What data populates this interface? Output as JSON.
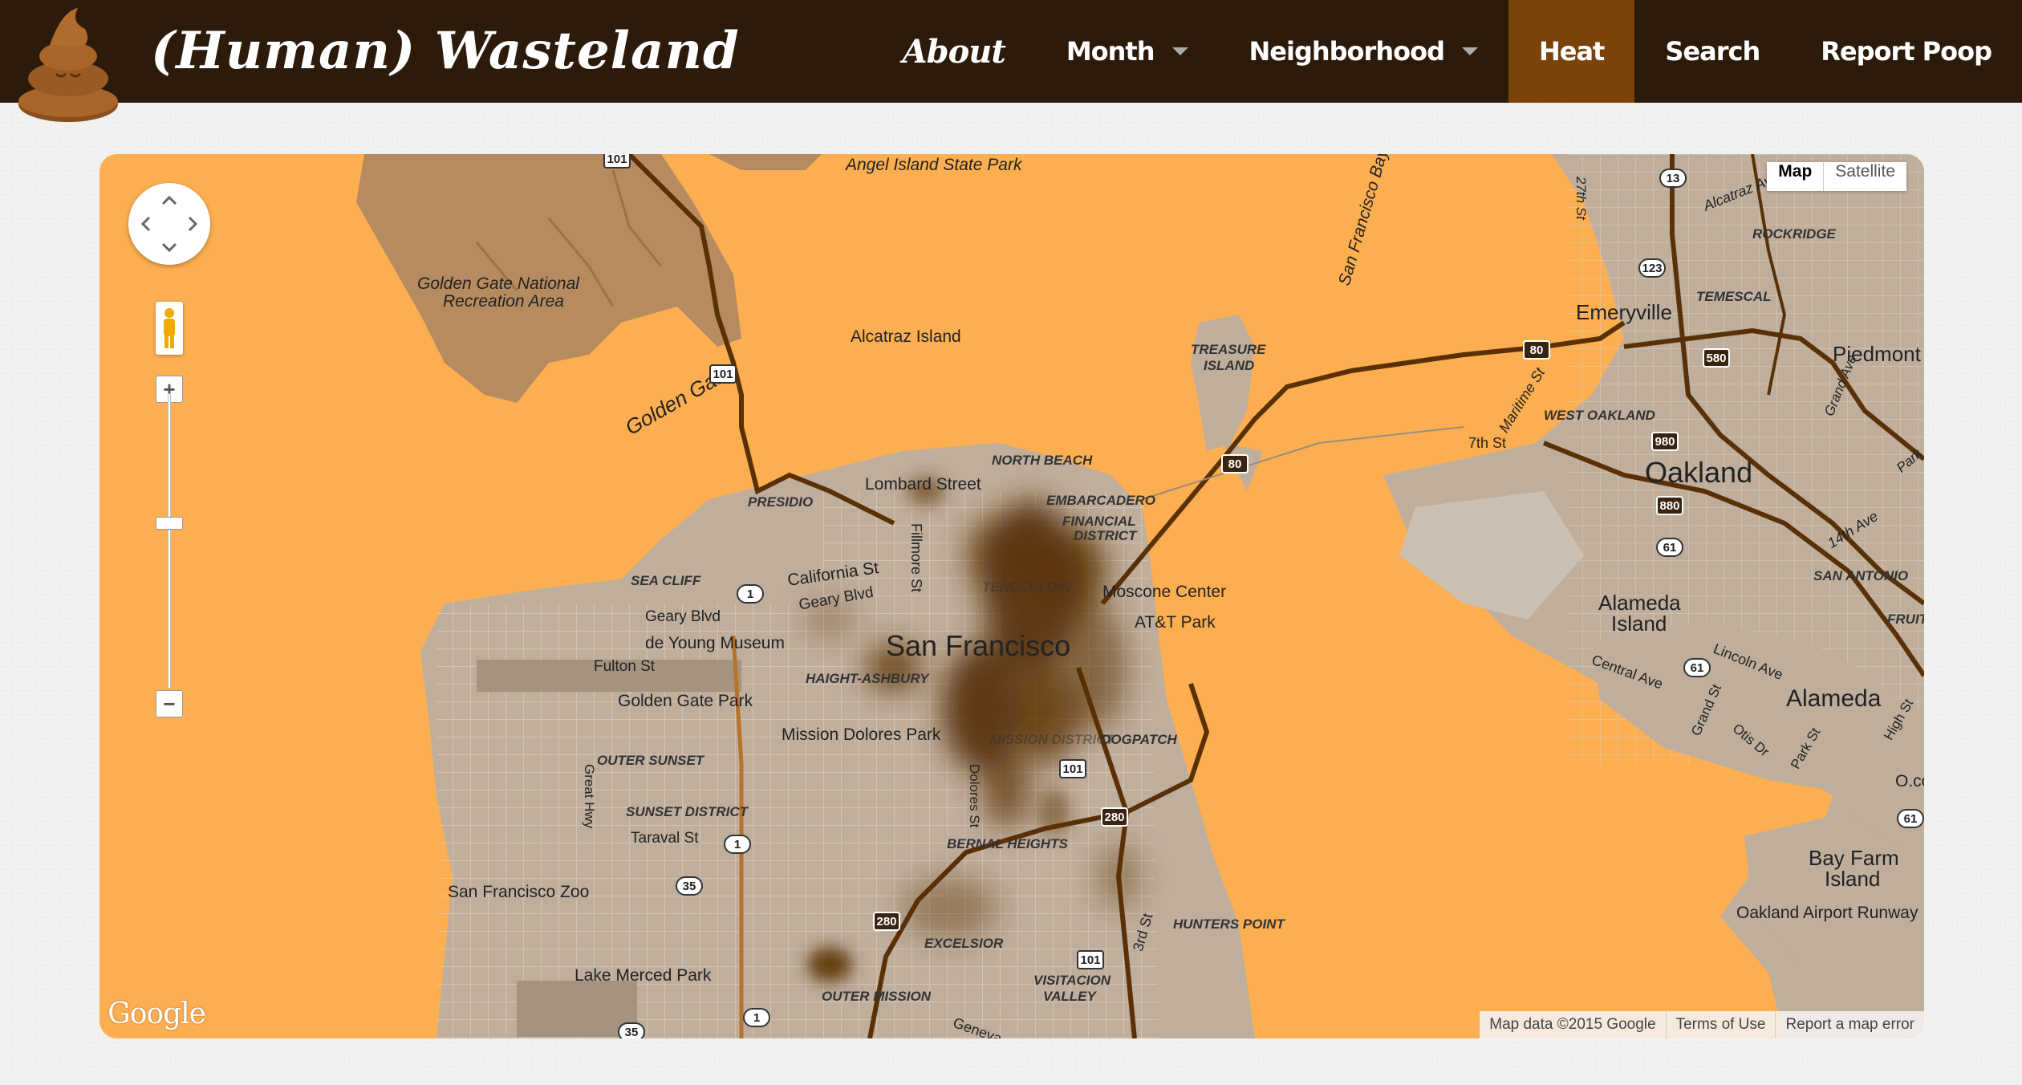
{
  "app": {
    "title": "(Human) Wasteland"
  },
  "nav": {
    "about": "About",
    "month": "Month",
    "neighborhood": "Neighborhood",
    "heat": "Heat",
    "search": "Search",
    "report": "Report Poop"
  },
  "colors": {
    "navbar": "#2c1a0a",
    "active_tab": "#7a4309",
    "water": "#fdae51",
    "land": "#bfae9c",
    "heat": "#5a3107"
  },
  "map": {
    "maptype": {
      "map": "Map",
      "satellite": "Satellite"
    },
    "google": "Google",
    "attribution": {
      "data": "Map data ©2015 Google",
      "terms": "Terms of Use",
      "report": "Report a map error"
    },
    "labels": {
      "angel": "Angel Island State Park",
      "ggnra1": "Golden Gate National",
      "ggnra2": "Recreation Area",
      "alcatraz": "Alcatraz Island",
      "treasure1": "TREASURE",
      "treasure2": "ISLAND",
      "sfbay": "San Francisco Bay",
      "golden_gate": "Golden Gate",
      "emeryville": "Emeryville",
      "rockridge": "ROCKRIDGE",
      "temescal": "TEMESCAL",
      "piedmont": "Piedmont",
      "west_oakland": "WEST OAKLAND",
      "oakland": "Oakland",
      "alcatraz_ave": "Alcatraz Ave",
      "maritime": "Maritime St",
      "seventh": "7th St",
      "fourteenth": "14th Ave",
      "san_antonio": "SAN ANTONIO",
      "grand_ave": "Grand Ave",
      "park": "Park",
      "north_beach": "NORTH BEACH",
      "lombard": "Lombard Street",
      "presidio": "PRESIDIO",
      "embarcadero": "EMBARCADERO",
      "financial": "FINANCIAL",
      "district": "DISTRICT",
      "sea_cliff": "SEA CLIFF",
      "california": "California St",
      "geary_blvd": "Geary Blvd",
      "geary_blvd2": "Geary Blvd",
      "fillmore": "Fillmore St",
      "tenderloin": "TENDERLOIN",
      "moscone": "Moscone Center",
      "att": "AT&T Park",
      "de_young": "de Young Museum",
      "fulton": "Fulton St",
      "haight": "HAIGHT-ASHBURY",
      "san_francisco": "San Francisco",
      "ggpark": "Golden Gate Park",
      "mission_dolores": "Mission Dolores Park",
      "mission_district": "MISSION DISTRICT",
      "outer_sunset": "OUTER SUNSET",
      "sunset_district": "SUNSET DISTRICT",
      "taraval": "Taraval St",
      "great_hwy": "Great Hwy",
      "dolores": "Dolores St",
      "dogpatch": "DOGPATCH",
      "bernal": "BERNAL HEIGHTS",
      "sf_zoo": "San Francisco Zoo",
      "lake_merced": "Lake Merced Park",
      "excelsior": "EXCELSIOR",
      "outer_mission": "OUTER MISSION",
      "visitacion1": "VISITACION",
      "visitacion2": "VALLEY",
      "hunters": "HUNTERS POINT",
      "third": "3rd St",
      "geneva": "Geneva",
      "alameda_island1": "Alameda",
      "alameda_island2": "Island",
      "central": "Central Ave",
      "lincoln": "Lincoln Ave",
      "alameda": "Alameda",
      "grand_st": "Grand St",
      "otis": "Otis Dr",
      "park_st": "Park St",
      "high_st": "High St",
      "fruit": "FRUIT",
      "bay_farm1": "Bay Farm",
      "bay_farm2": "Island",
      "oak_airport": "Oakland Airport Runway",
      "o_co": "O.co",
      "twentyseventh": "27th St"
    },
    "shields": {
      "s101": "101",
      "s101b": "101",
      "s101c": "101",
      "s101top": "101",
      "s80a": "80",
      "s80b": "80",
      "s1a": "1",
      "s1b": "1",
      "s1c": "1",
      "s13": "13",
      "s123": "123",
      "s580": "580",
      "s980": "980",
      "s880": "880",
      "s61a": "61",
      "s61b": "61",
      "s61c": "61",
      "s35a": "35",
      "s35b": "35",
      "s280a": "280",
      "s280b": "280"
    }
  }
}
